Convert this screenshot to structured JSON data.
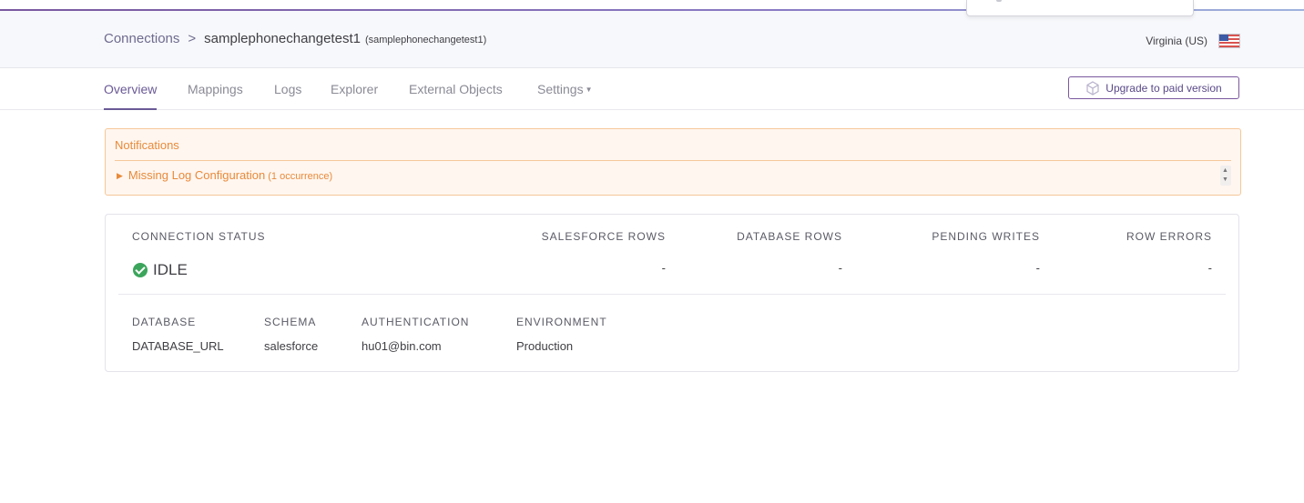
{
  "breadcrumb": {
    "root": "Connections",
    "separator": ">",
    "current": "samplephonechangetest1",
    "current_sub": "(samplephonechangetest1)"
  },
  "region": {
    "label": "Virginia (US)",
    "flag_icon": "us-flag-icon"
  },
  "tabs": [
    {
      "label": "Overview",
      "active": true
    },
    {
      "label": "Mappings"
    },
    {
      "label": "Logs"
    },
    {
      "label": "Explorer"
    },
    {
      "label": "External Objects"
    },
    {
      "label": "Settings",
      "dropdown": true
    }
  ],
  "upgrade": {
    "label": "Upgrade to paid version",
    "icon": "cube-icon"
  },
  "notifications": {
    "title": "Notifications",
    "items": [
      {
        "label": "Missing Log Configuration",
        "count": "(1 occurrence)"
      }
    ]
  },
  "stats": {
    "connection_status_label": "CONNECTION STATUS",
    "status_value": "IDLE",
    "salesforce_rows_label": "SALESFORCE ROWS",
    "salesforce_rows_value": "-",
    "database_rows_label": "DATABASE ROWS",
    "database_rows_value": "-",
    "pending_writes_label": "PENDING WRITES",
    "pending_writes_value": "-",
    "row_errors_label": "ROW ERRORS",
    "row_errors_value": "-"
  },
  "details": {
    "database_label": "DATABASE",
    "database_value": "DATABASE_URL",
    "schema_label": "SCHEMA",
    "schema_value": "salesforce",
    "authentication_label": "AUTHENTICATION",
    "authentication_value": "hu01@bin.com",
    "environment_label": "ENVIRONMENT",
    "environment_value": "Production"
  },
  "colors": {
    "accent": "#79589f",
    "warning": "#e88a3a",
    "success": "#3ca55c"
  }
}
